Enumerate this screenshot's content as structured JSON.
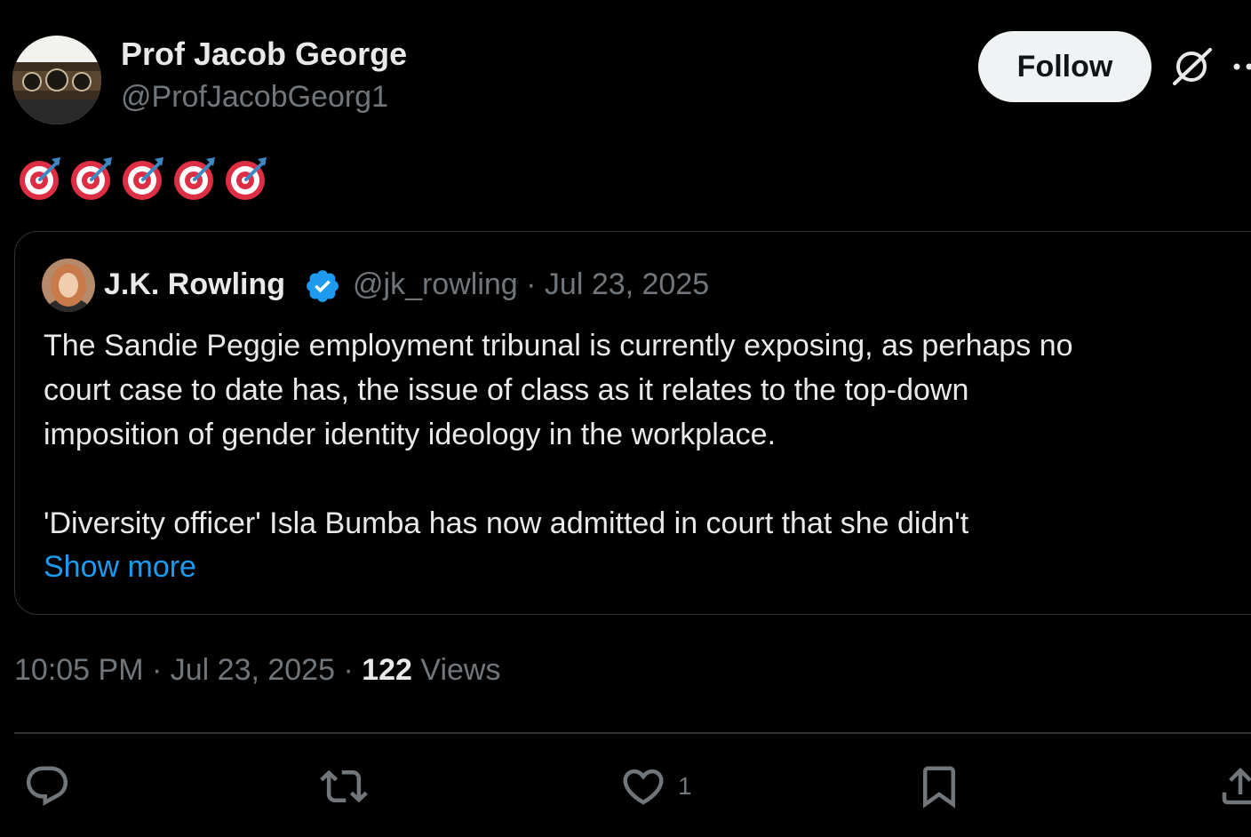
{
  "author": {
    "display_name": "Prof Jacob George",
    "handle": "@ProfJacobGeorg1"
  },
  "follow_label": "Follow",
  "post_text_emojis": [
    "🎯",
    "🎯",
    "🎯",
    "🎯",
    "🎯"
  ],
  "quoted_post": {
    "display_name": "J.K. Rowling",
    "verified": true,
    "meta": "@jk_rowling · Jul 23, 2025",
    "lines": [
      "The Sandie Peggie employment tribunal is currently exposing, as perhaps no",
      "court case to date has, the issue of class as it relates to the top-down",
      "imposition of gender identity ideology in the workplace.",
      "'Diversity officer' Isla Bumba has now admitted in court that she didn't"
    ],
    "show_more": "Show more"
  },
  "post_meta": {
    "time": "10:05 PM · Jul 23, 2025 · ",
    "views_count": "122",
    "views_label": " Views"
  },
  "actions": {
    "like_count": "1"
  },
  "colors": {
    "background": "#000000",
    "text_primary": "#e7e9ea",
    "text_secondary": "#71767b",
    "accent": "#1d9bf0",
    "border": "#2f3336",
    "button_bg": "#eff3f4"
  },
  "icons": [
    "grok-icon",
    "more-icon",
    "verified-icon",
    "reply-icon",
    "repost-icon",
    "like-icon",
    "bookmark-icon",
    "share-icon"
  ]
}
